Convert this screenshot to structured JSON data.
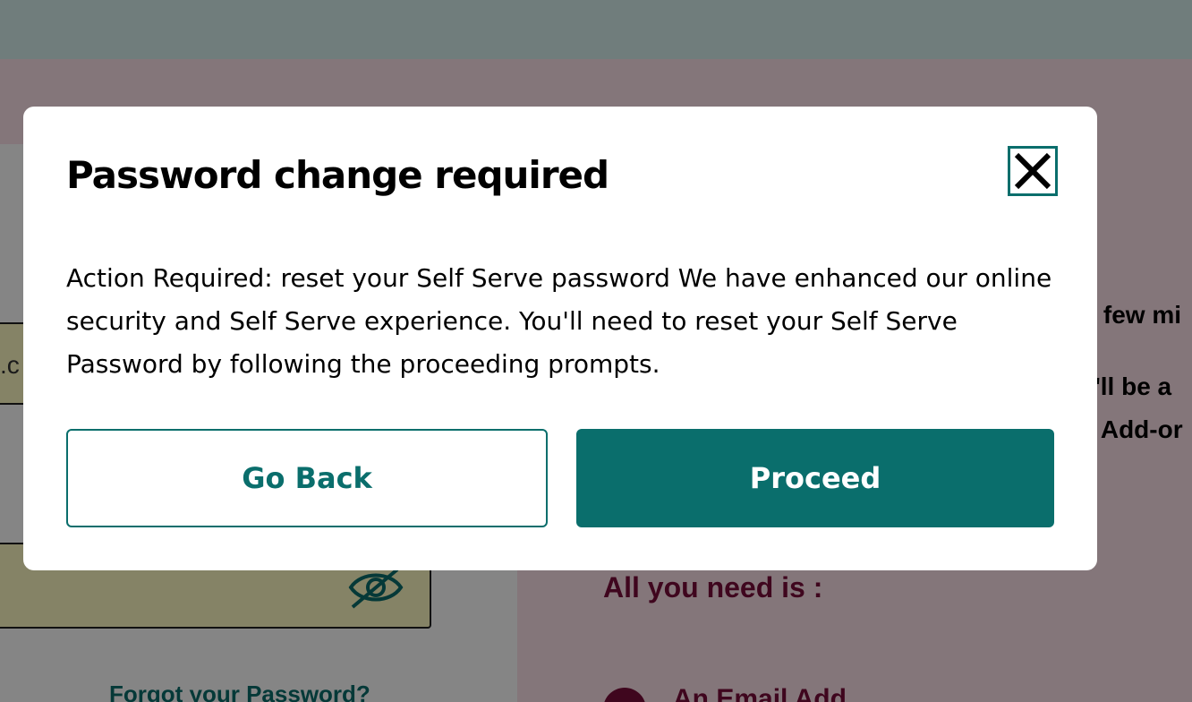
{
  "background": {
    "email_field_fragment": ".c",
    "forgot_password_link": "Forgot your Password?",
    "right_panel_lines": [
      "n few mi",
      "u'll be a",
      "n Add-or"
    ],
    "all_you_need_heading": "All you need is :",
    "requirement_item": "An Email Add"
  },
  "modal": {
    "title": "Password change required",
    "body": "Action Required: reset your Self Serve password We have enhanced our online security and Self Serve experience. You'll need to reset your Self Serve Password by following the proceeding prompts.",
    "go_back_label": "Go Back",
    "proceed_label": "Proceed"
  },
  "colors": {
    "accent": "#0a6e6c",
    "brand_maroon": "#7a0c3a",
    "field_fill": "#fffbc4"
  },
  "icons": {
    "close": "close-icon",
    "password_visibility": "eye-slash-icon",
    "checkmark": "check-icon"
  }
}
